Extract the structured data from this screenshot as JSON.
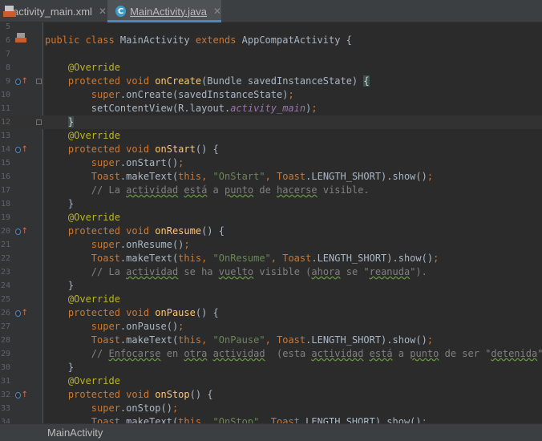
{
  "tabs": [
    {
      "label": "activity_main.xml",
      "icon": "xml-file-icon",
      "active": false
    },
    {
      "label": "MainActivity.java",
      "icon": "java-class-icon",
      "active": true
    }
  ],
  "class_name": "MainActivity",
  "lines": [
    {
      "n": "5",
      "segs": []
    },
    {
      "n": "6",
      "segs": [
        [
          "k",
          "public class "
        ],
        [
          "p",
          "MainActivity "
        ],
        [
          "k",
          "extends "
        ],
        [
          "p",
          "AppCompatActivity {"
        ]
      ]
    },
    {
      "n": "7",
      "segs": []
    },
    {
      "n": "8",
      "segs": [
        [
          "p",
          "    "
        ],
        [
          "a2",
          "@Override"
        ]
      ]
    },
    {
      "n": "9",
      "segs": [
        [
          "p",
          "    "
        ],
        [
          "k",
          "protected void "
        ],
        [
          "f",
          "onCreate"
        ],
        [
          "p",
          "(Bundle savedInstanceState) "
        ],
        [
          "gb",
          "{"
        ]
      ]
    },
    {
      "n": "10",
      "segs": [
        [
          "p",
          "        "
        ],
        [
          "k",
          "super"
        ],
        [
          "p",
          ".onCreate(savedInstanceState)"
        ],
        [
          "k",
          ";"
        ]
      ]
    },
    {
      "n": "11",
      "segs": [
        [
          "p",
          "        setContentView(R.layout."
        ],
        [
          "sp",
          "activity_main"
        ],
        [
          "p",
          ")"
        ],
        [
          "k",
          ";"
        ]
      ]
    },
    {
      "n": "12",
      "segs": [
        [
          "p",
          "    "
        ],
        [
          "gb",
          "}"
        ]
      ]
    },
    {
      "n": "13",
      "segs": [
        [
          "p",
          "    "
        ],
        [
          "a2",
          "@Override"
        ]
      ]
    },
    {
      "n": "14",
      "segs": [
        [
          "p",
          "    "
        ],
        [
          "k",
          "protected void "
        ],
        [
          "f",
          "onStart"
        ],
        [
          "p",
          "() {"
        ]
      ]
    },
    {
      "n": "15",
      "segs": [
        [
          "p",
          "        "
        ],
        [
          "k",
          "super"
        ],
        [
          "p",
          ".onStart()"
        ],
        [
          "k",
          ";"
        ]
      ]
    },
    {
      "n": "16",
      "segs": [
        [
          "p",
          "        "
        ],
        [
          "k",
          "Toast"
        ],
        [
          "p",
          ".makeText("
        ],
        [
          "k",
          "this, "
        ],
        [
          "s",
          "\"OnStart\""
        ],
        [
          "k",
          ", Toast"
        ],
        [
          "p",
          ".LENGTH_SHORT).show()"
        ],
        [
          "k",
          ";"
        ]
      ]
    },
    {
      "n": "17",
      "segs": [
        [
          "c",
          "        // La "
        ],
        [
          "cs",
          "actividad"
        ],
        [
          "c",
          " "
        ],
        [
          "cs",
          "está"
        ],
        [
          "c",
          " a "
        ],
        [
          "cs",
          "punto"
        ],
        [
          "c",
          " de "
        ],
        [
          "cs",
          "hacerse"
        ],
        [
          "c",
          " visible."
        ]
      ]
    },
    {
      "n": "18",
      "segs": [
        [
          "p",
          "    }"
        ]
      ]
    },
    {
      "n": "19",
      "segs": [
        [
          "p",
          "    "
        ],
        [
          "a2",
          "@Override"
        ]
      ]
    },
    {
      "n": "20",
      "segs": [
        [
          "p",
          "    "
        ],
        [
          "k",
          "protected void "
        ],
        [
          "f",
          "onResume"
        ],
        [
          "p",
          "() {"
        ]
      ]
    },
    {
      "n": "21",
      "segs": [
        [
          "p",
          "        "
        ],
        [
          "k",
          "super"
        ],
        [
          "p",
          ".onResume()"
        ],
        [
          "k",
          ";"
        ]
      ]
    },
    {
      "n": "22",
      "segs": [
        [
          "p",
          "        "
        ],
        [
          "k",
          "Toast"
        ],
        [
          "p",
          ".makeText("
        ],
        [
          "k",
          "this, "
        ],
        [
          "s",
          "\"OnResume\""
        ],
        [
          "k",
          ", Toast"
        ],
        [
          "p",
          ".LENGTH_SHORT).show()"
        ],
        [
          "k",
          ";"
        ]
      ]
    },
    {
      "n": "23",
      "segs": [
        [
          "c",
          "        // La "
        ],
        [
          "cs",
          "actividad"
        ],
        [
          "c",
          " se ha "
        ],
        [
          "cs",
          "vuelto"
        ],
        [
          "c",
          " visible ("
        ],
        [
          "cs",
          "ahora"
        ],
        [
          "c",
          " se \""
        ],
        [
          "cs",
          "reanuda"
        ],
        [
          "c",
          "\")."
        ]
      ]
    },
    {
      "n": "24",
      "segs": [
        [
          "p",
          "    }"
        ]
      ]
    },
    {
      "n": "25",
      "segs": [
        [
          "p",
          "    "
        ],
        [
          "a2",
          "@Override"
        ]
      ]
    },
    {
      "n": "26",
      "segs": [
        [
          "p",
          "    "
        ],
        [
          "k",
          "protected void "
        ],
        [
          "f",
          "onPause"
        ],
        [
          "p",
          "() {"
        ]
      ]
    },
    {
      "n": "27",
      "segs": [
        [
          "p",
          "        "
        ],
        [
          "k",
          "super"
        ],
        [
          "p",
          ".onPause()"
        ],
        [
          "k",
          ";"
        ]
      ]
    },
    {
      "n": "28",
      "segs": [
        [
          "p",
          "        "
        ],
        [
          "k",
          "Toast"
        ],
        [
          "p",
          ".makeText("
        ],
        [
          "k",
          "this, "
        ],
        [
          "s",
          "\"OnPause\""
        ],
        [
          "k",
          ", Toast"
        ],
        [
          "p",
          ".LENGTH_SHORT).show()"
        ],
        [
          "k",
          ";"
        ]
      ]
    },
    {
      "n": "29",
      "segs": [
        [
          "c",
          "        // "
        ],
        [
          "cs",
          "Enfocarse"
        ],
        [
          "c",
          " en "
        ],
        [
          "cs",
          "otra"
        ],
        [
          "c",
          " "
        ],
        [
          "cs",
          "actividad"
        ],
        [
          "c",
          "  (esta "
        ],
        [
          "cs",
          "actividad"
        ],
        [
          "c",
          " "
        ],
        [
          "cs",
          "está"
        ],
        [
          "c",
          " a "
        ],
        [
          "cs",
          "punto"
        ],
        [
          "c",
          " de ser \""
        ],
        [
          "cs",
          "detenida"
        ],
        [
          "c",
          "\")."
        ]
      ]
    },
    {
      "n": "30",
      "segs": [
        [
          "p",
          "    }"
        ]
      ]
    },
    {
      "n": "31",
      "segs": [
        [
          "p",
          "    "
        ],
        [
          "a2",
          "@Override"
        ]
      ]
    },
    {
      "n": "32",
      "segs": [
        [
          "p",
          "    "
        ],
        [
          "k",
          "protected void "
        ],
        [
          "f",
          "onStop"
        ],
        [
          "p",
          "() {"
        ]
      ]
    },
    {
      "n": "33",
      "segs": [
        [
          "p",
          "        "
        ],
        [
          "k",
          "super"
        ],
        [
          "p",
          ".onStop()"
        ],
        [
          "k",
          ";"
        ]
      ]
    },
    {
      "n": "34",
      "segs": [
        [
          "p",
          "        "
        ],
        [
          "k",
          "Toast"
        ],
        [
          "p",
          ".makeText("
        ],
        [
          "k",
          "this, "
        ],
        [
          "s",
          "\"OnStop\""
        ],
        [
          "k",
          ", Toast"
        ],
        [
          "p",
          ".LENGTH_SHORT).show()"
        ],
        [
          "k",
          ";"
        ]
      ]
    }
  ],
  "override_markers": [
    "9",
    "14",
    "20",
    "26",
    "32"
  ],
  "fold_markers": [
    "9",
    "12"
  ],
  "caret_line": "12",
  "status": {
    "breadcrumb": "MainActivity"
  }
}
